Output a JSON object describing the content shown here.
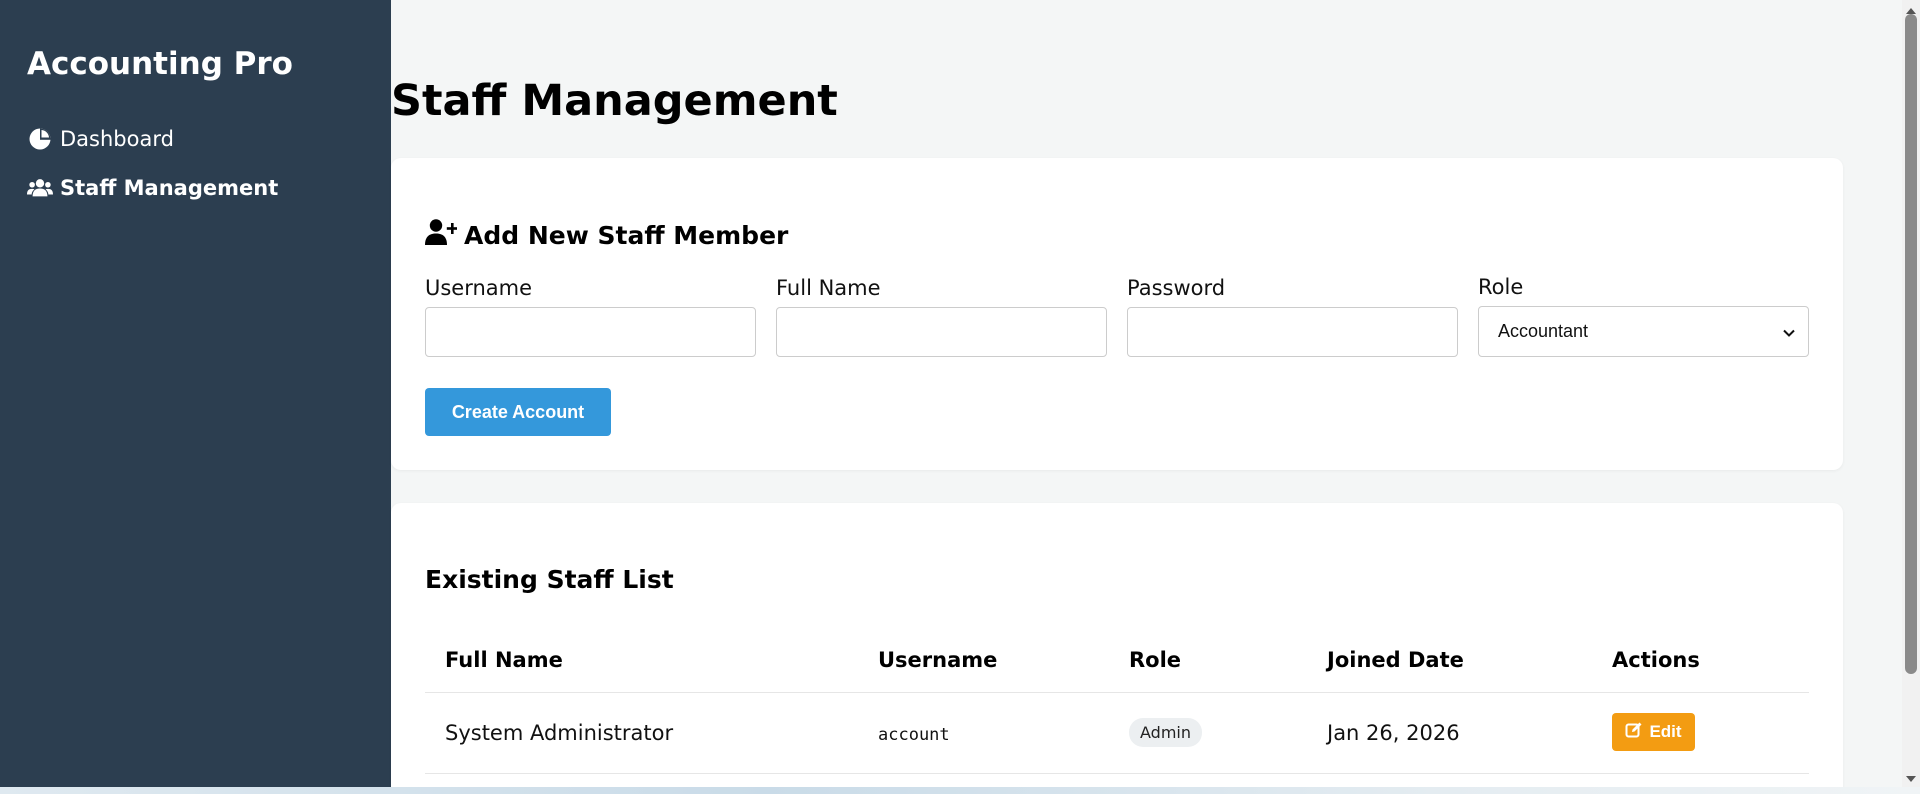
{
  "sidebar": {
    "brand": "Accounting Pro",
    "items": [
      {
        "label": "Dashboard",
        "icon": "chart-pie-icon",
        "active": false
      },
      {
        "label": "Staff Management",
        "icon": "users-icon",
        "active": true
      }
    ]
  },
  "page": {
    "title": "Staff Management"
  },
  "add_form": {
    "heading": "Add New Staff Member",
    "heading_icon": "user-plus-icon",
    "fields": {
      "username": {
        "label": "Username",
        "value": ""
      },
      "full_name": {
        "label": "Full Name",
        "value": ""
      },
      "password": {
        "label": "Password",
        "value": ""
      },
      "role": {
        "label": "Role",
        "selected": "Accountant"
      }
    },
    "submit_label": "Create Account"
  },
  "staff_list": {
    "heading": "Existing Staff List",
    "columns": [
      "Full Name",
      "Username",
      "Role",
      "Joined Date",
      "Actions"
    ],
    "rows": [
      {
        "full_name": "System Administrator",
        "username": "account",
        "role": "Admin",
        "joined": "Jan 26, 2026",
        "action_label": "Edit"
      }
    ]
  },
  "colors": {
    "sidebar_bg": "#2c3e50",
    "primary": "#3498db",
    "warning": "#f39c12",
    "page_bg": "#f4f6f6"
  }
}
